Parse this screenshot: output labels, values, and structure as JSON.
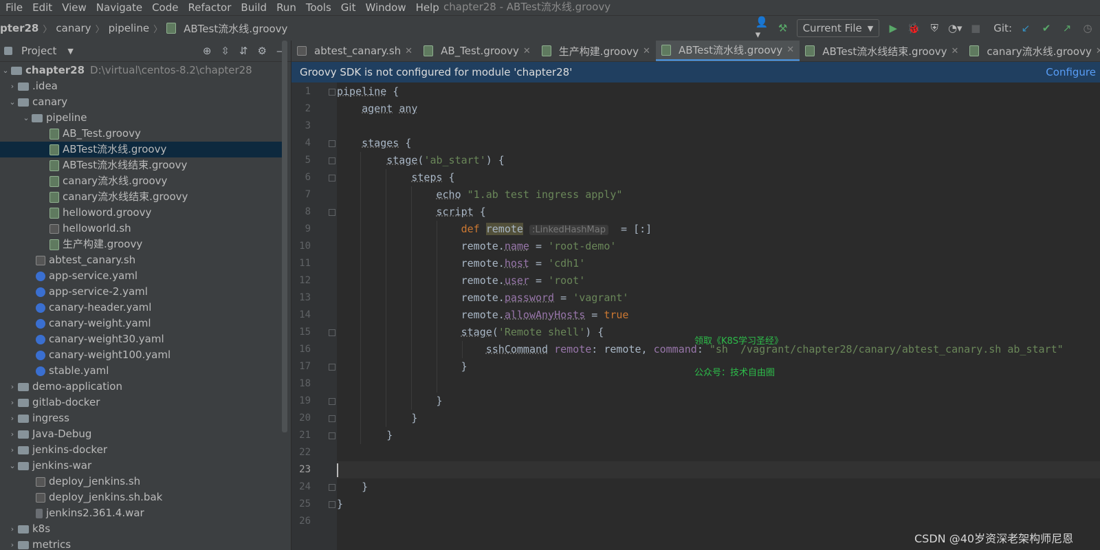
{
  "menubar": {
    "items": [
      "File",
      "Edit",
      "View",
      "Navigate",
      "Code",
      "Refactor",
      "Build",
      "Run",
      "Tools",
      "Git",
      "Window",
      "Help"
    ],
    "window_title": "chapter28 - ABTest流水线.groovy"
  },
  "navbar": {
    "crumbs": [
      "pter28",
      "canary",
      "pipeline",
      "ABTest流水线.groovy"
    ],
    "run_config": "Current File",
    "git_label": "Git:"
  },
  "project": {
    "title": "Project",
    "root_name": "chapter28",
    "root_path": "D:\\virtual\\centos-8.2\\chapter28",
    "items": [
      ".idea",
      "canary",
      "pipeline",
      "AB_Test.groovy",
      "ABTest流水线.groovy",
      "ABTest流水线结束.groovy",
      "canary流水线.groovy",
      "canary流水线结束.groovy",
      "helloword.groovy",
      "helloworld.sh",
      "生产构建.groovy",
      "abtest_canary.sh",
      "app-service.yaml",
      "app-service-2.yaml",
      "canary-header.yaml",
      "canary-weight.yaml",
      "canary-weight30.yaml",
      "canary-weight100.yaml",
      "stable.yaml",
      "demo-application",
      "gitlab-docker",
      "ingress",
      "Java-Debug",
      "jenkins-docker",
      "jenkins-war",
      "deploy_jenkins.sh",
      "deploy_jenkins.sh.bak",
      "jenkins2.361.4.war",
      "k8s",
      "metrics"
    ]
  },
  "tabs": [
    "abtest_canary.sh",
    "AB_Test.groovy",
    "生产构建.groovy",
    "ABTest流水线.groovy",
    "ABTest流水线结束.groovy",
    "canary流水线.groovy",
    "cana"
  ],
  "notification": {
    "message": "Groovy SDK is not configured for module 'chapter28'",
    "action": "Configure"
  },
  "code": {
    "line_numbers": [
      "1",
      "2",
      "3",
      "4",
      "5",
      "6",
      "7",
      "8",
      "9",
      "10",
      "11",
      "12",
      "13",
      "14",
      "15",
      "16",
      "17",
      "18",
      "19",
      "20",
      "21",
      "22",
      "23",
      "24",
      "25",
      "26"
    ],
    "type_hint": ":LinkedHashMap"
  },
  "overlay": {
    "line1": "领取《K8S学习圣经》",
    "line2": "公众号：技术自由圈"
  },
  "watermark": "CSDN @40岁资深老架构师尼恩"
}
